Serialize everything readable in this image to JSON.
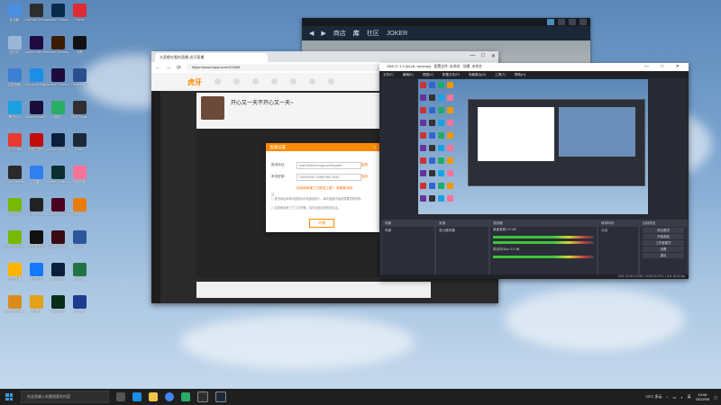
{
  "desktop": {
    "icons": [
      {
        "label": "此电脑",
        "color": "#4a8fe2"
      },
      {
        "label": "DaVinci Resolve",
        "color": "#2d2d2d"
      },
      {
        "label": "Adobe Photoshop",
        "color": "#0a2b4b"
      },
      {
        "label": "Opera",
        "color": "#e02a36"
      },
      {
        "label": "回收站",
        "color": "#9bb7d8"
      },
      {
        "label": "Adobe After Effects",
        "color": "#1f0b40"
      },
      {
        "label": "Adobe Illustrator",
        "color": "#3a1d00"
      },
      {
        "label": "抖音",
        "color": "#111"
      },
      {
        "label": "控制面板",
        "color": "#3a7fd3"
      },
      {
        "label": "Microsoft Edge",
        "color": "#1b8ee6"
      },
      {
        "label": "Adobe Premiere",
        "color": "#1d0b3d"
      },
      {
        "label": "Cinema 4D",
        "color": "#2a4f8f"
      },
      {
        "label": "腾讯QQ",
        "color": "#1ba1e2"
      },
      {
        "label": "Adobe Media Encoder",
        "color": "#1a0d38"
      },
      {
        "label": "微信",
        "color": "#2aae67"
      },
      {
        "label": "OBS Studio",
        "color": "#302e31"
      },
      {
        "label": "WPS Office",
        "color": "#e63b2e"
      },
      {
        "label": "网易云音乐",
        "color": "#c20c0c"
      },
      {
        "label": "Adobe Lightroom",
        "color": "#0b1f3a"
      },
      {
        "label": "Steam",
        "color": "#1b2838"
      },
      {
        "label": "Epic Games",
        "color": "#2a2a2a"
      },
      {
        "label": "迅雷",
        "color": "#2f7ff0"
      },
      {
        "label": "Adobe Audition",
        "color": "#0a2f2f"
      },
      {
        "label": "哔哩哔哩",
        "color": "#fb7299"
      },
      {
        "label": "NVIDIA",
        "color": "#76b900"
      },
      {
        "label": "Unity Hub",
        "color": "#222"
      },
      {
        "label": "Adobe InDesign",
        "color": "#49021f"
      },
      {
        "label": "Blender",
        "color": "#e87d0d"
      },
      {
        "label": "GeForce Experience",
        "color": "#76b900"
      },
      {
        "label": "剪映专业版",
        "color": "#111"
      },
      {
        "label": "Adobe Animate",
        "color": "#3a0b12"
      },
      {
        "label": "Word",
        "color": "#2b579a"
      },
      {
        "label": "虎牙直播",
        "color": "#ffb400"
      },
      {
        "label": "腾讯会议",
        "color": "#1677ff"
      },
      {
        "label": "Adobe Lrc",
        "color": "#0b1f3a"
      },
      {
        "label": "Excel",
        "color": "#217346"
      },
      {
        "label": "Counter-Strike",
        "color": "#d98c1b"
      },
      {
        "label": "PUBG",
        "color": "#e1a21a"
      },
      {
        "label": "Adobe Dw",
        "color": "#072d1b"
      },
      {
        "label": "Aim Lab",
        "color": "#1d3c8f"
      }
    ]
  },
  "steam": {
    "nav": [
      "商店",
      "库",
      "社区",
      "JOKER"
    ]
  },
  "browser": {
    "tab_title": "大家都在看的直播·虎牙直播",
    "url": "https://www.huya.com/123456",
    "site_logo": "虎牙",
    "room_title": "开心又一天不开心又一天~",
    "window_controls": [
      "—",
      "□",
      "✕"
    ],
    "nav_buttons": [
      "←",
      "→",
      "⟳"
    ]
  },
  "dialog": {
    "title": "直播设置",
    "close": "×",
    "server_label": "推流地址：",
    "server_value": "rtmp://al.direct.huya.com/huyalive",
    "key_label": "串流密钥：",
    "key_value": "1199979467-1199979467-5152...",
    "copy1": "复制",
    "copy2": "复制",
    "hint_link": "如何使用第三方推流工具？ 获取推流码",
    "notes": [
      "注：",
      "1. 推流地址和串流密钥请勿泄露给他人，每次直播开始前需要重新获取。",
      "2. 如需使用第三方工具开播，请在此处复制相关信息。"
    ],
    "confirm": "开播"
  },
  "obs": {
    "title": "OBS 27.1.3 (64-bit, windows) - 配置文件: 未命名 - 场景: 未命名",
    "menu": [
      "文件(F)",
      "编辑(E)",
      "视图(V)",
      "配置文件(P)",
      "场景集合(S)",
      "工具(T)",
      "帮助(H)"
    ],
    "window_controls": "— □ ✕",
    "panels": {
      "scenes": "场景",
      "scene_item": "场景",
      "sources": "来源",
      "source_item": "显示器采集",
      "mixer": "混音器",
      "mixer_tracks": [
        "桌面音频 0.0 dB",
        "麦克风/Aux 0.0 dB"
      ],
      "transitions": "转场特效",
      "transition_value": "淡出",
      "controls": "控制按钮"
    },
    "control_buttons": [
      "停止推流",
      "开始录制",
      "工作室模式",
      "设置",
      "退出"
    ],
    "status": "LIVE: 00:00:12  REC: 00:00:00  CPU: 1.2%, 60.00 fps"
  },
  "taskbar": {
    "search_placeholder": "在这里输入你要搜索的内容",
    "weather": "23°C 多云",
    "time": "19:06",
    "date": "2022/5/9",
    "ime": "英"
  }
}
